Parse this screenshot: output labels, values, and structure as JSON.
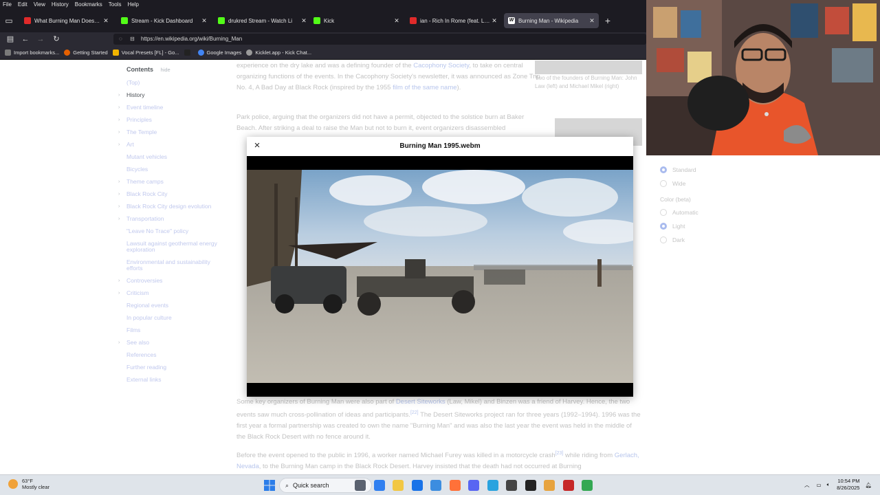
{
  "menubar": [
    "File",
    "Edit",
    "View",
    "History",
    "Bookmarks",
    "Tools",
    "Help"
  ],
  "tabs": [
    {
      "title": "What Burning Man Doesn't Wa",
      "color": "#e02a2a",
      "active": false
    },
    {
      "title": "Stream - Kick Dashboard",
      "color": "#53fc18",
      "active": false
    },
    {
      "title": "drukred Stream - Watch Li",
      "color": "#53fc18",
      "active": false
    },
    {
      "title": "Kick",
      "color": "#53fc18",
      "active": false
    },
    {
      "title": "ian - Rich In Rome (feat. LAZER",
      "color": "#e02a2a",
      "active": false
    },
    {
      "title": "Burning Man - Wikipedia",
      "color": "#ffffff",
      "active": true
    }
  ],
  "url": "https://en.wikipedia.org/wiki/Burning_Man",
  "bookmarks": [
    {
      "label": "Import bookmarks...",
      "color": "#7a7a7a"
    },
    {
      "label": "Getting Started",
      "color": "#e66000"
    },
    {
      "label": "Vocal Presets [FL] - Go...",
      "color": "#f1b400"
    },
    {
      "label": "",
      "color": "#222222"
    },
    {
      "label": "Google Images",
      "color": "#4285f4"
    },
    {
      "label": "Kicklet.app - Kick Chat...",
      "color": "#9a9a9a"
    }
  ],
  "toc": {
    "title": "Contents",
    "hide": "hide",
    "items": [
      {
        "label": "(Top)",
        "chev": false,
        "strong": false
      },
      {
        "label": "History",
        "chev": true,
        "strong": true
      },
      {
        "label": "Event timeline",
        "chev": true,
        "strong": false
      },
      {
        "label": "Principles",
        "chev": true,
        "strong": false
      },
      {
        "label": "The Temple",
        "chev": true,
        "strong": false
      },
      {
        "label": "Art",
        "chev": true,
        "strong": false
      },
      {
        "label": "Mutant vehicles",
        "chev": false,
        "strong": false
      },
      {
        "label": "Bicycles",
        "chev": false,
        "strong": false
      },
      {
        "label": "Theme camps",
        "chev": true,
        "strong": false
      },
      {
        "label": "Black Rock City",
        "chev": true,
        "strong": false
      },
      {
        "label": "Black Rock City design evolution",
        "chev": true,
        "strong": false
      },
      {
        "label": "Transportation",
        "chev": true,
        "strong": false
      },
      {
        "label": "\"Leave No Trace\" policy",
        "chev": false,
        "strong": false
      },
      {
        "label": "Lawsuit against geothermal energy exploration",
        "chev": false,
        "strong": false
      },
      {
        "label": "Environmental and sustainability efforts",
        "chev": false,
        "strong": false
      },
      {
        "label": "Controversies",
        "chev": true,
        "strong": false
      },
      {
        "label": "Criticism",
        "chev": true,
        "strong": false
      },
      {
        "label": "Regional events",
        "chev": false,
        "strong": false
      },
      {
        "label": "In popular culture",
        "chev": false,
        "strong": false
      },
      {
        "label": "Films",
        "chev": false,
        "strong": false
      },
      {
        "label": "See also",
        "chev": true,
        "strong": false
      },
      {
        "label": "References",
        "chev": false,
        "strong": false
      },
      {
        "label": "Further reading",
        "chev": false,
        "strong": false
      },
      {
        "label": "External links",
        "chev": false,
        "strong": false
      }
    ]
  },
  "article": {
    "p1a": "experience on the dry lake and was a defining founder of the ",
    "p1link1": "Cacophony Society",
    "p1b": ", to take on central organizing functions of the events. In the Cacophony Society's newsletter, it was announced as Zone Trip No. 4, A Bad Day at Black Rock (inspired by the 1955 ",
    "p1link2": "film of the same name",
    "p1c": ").",
    "p2": "Park police, arguing that the organizers did not have a permit, objected to the solstice burn at Baker Beach. After striking a deal to raise the Man but not to burn it, event organizers disassembled",
    "p3a": "Some key organizers of Burning Man were also part of ",
    "p3link": "Desert Siteworks",
    "p3b": " (Law, Mikel) and Binzen was a friend of Harvey. Hence, the two events saw much cross-pollination of ideas and participants.",
    "p3ref": "[22]",
    "p3c": " The Desert Siteworks project ran for three years (1992–1994). 1996 was the first year a formal partnership was created to own the name \"Burning Man\" and was also the last year the event was held in the middle of the Black Rock Desert with no fence around it.",
    "p4a": "Before the event opened to the public in 1996, a worker named Michael Furey was killed in a motorcycle crash",
    "p4ref": "[23]",
    "p4b": " while riding from ",
    "p4link": "Gerlach, Nevada",
    "p4c": ", to the Burning Man camp in the Black Rock Desert. Harvey insisted that the death had not occurred at Burning"
  },
  "thumb_caption": "Two of the founders of Burning Man: John Law (left) and Michael Mikel (right)",
  "appearance": {
    "text_options": [
      {
        "label": "Standard",
        "on": true
      },
      {
        "label": "Wide",
        "on": false
      }
    ],
    "color_title": "Color (beta)",
    "color_options": [
      {
        "label": "Automatic",
        "on": false
      },
      {
        "label": "Light",
        "on": true
      },
      {
        "label": "Dark",
        "on": false
      }
    ]
  },
  "modal": {
    "title": "Burning Man 1995.webm",
    "close": "×"
  },
  "taskbar": {
    "temp": "63°F",
    "weather": "Mostly clear",
    "search": "Quick search",
    "time": "10:54 PM",
    "date": "8/26/2025",
    "apps": [
      "#5a6270",
      "#2f7ff0",
      "#f2c744",
      "#1a73e8",
      "#3c8de0",
      "#ff7139",
      "#5865f2",
      "#2aa3df",
      "#444444",
      "#222222",
      "#e7a33e",
      "#c62828",
      "#34a853"
    ]
  }
}
